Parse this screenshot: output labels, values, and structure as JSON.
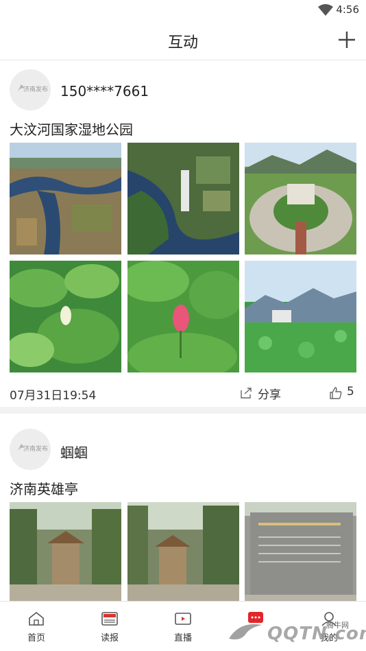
{
  "status_bar": {
    "time": "4:56"
  },
  "header": {
    "title": "互动"
  },
  "posts": [
    {
      "username": "150****7661",
      "avatar_text": "济南发布",
      "title": "大汶河国家湿地公园",
      "date": "07月31日19:54",
      "share_label": "分享",
      "like_count": "5",
      "photos": [
        "aerial-river-delta",
        "aerial-river-bend",
        "memorial-arch-plaza",
        "lotus-leaves",
        "pink-lotus-bud",
        "lotus-field-mountains"
      ]
    },
    {
      "username": "蝈蝈",
      "avatar_text": "济南发布",
      "title": "济南英雄亭",
      "photos": [
        "pavilion-front",
        "pavilion-side",
        "memorial-stone-wall"
      ]
    }
  ],
  "tabbar": {
    "items": [
      {
        "label": "首页",
        "icon": "home-icon"
      },
      {
        "label": "读报",
        "icon": "news-icon"
      },
      {
        "label": "直播",
        "icon": "live-icon"
      },
      {
        "label": "",
        "icon": "interact-icon"
      },
      {
        "label": "我的",
        "icon": "profile-icon"
      }
    ]
  },
  "watermark": {
    "text": "QQTN.com",
    "small": "腾牛网"
  },
  "colors": {
    "accent": "#e3262b",
    "text": "#222222",
    "divider": "#f2f2f2"
  }
}
